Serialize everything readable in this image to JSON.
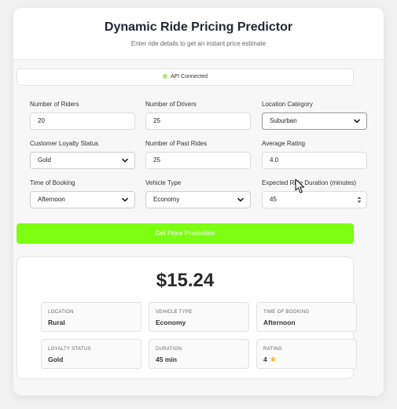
{
  "header": {
    "title": "Dynamic Ride Pricing Predictor",
    "subtitle": "Enter ride details to get an instant price estimate"
  },
  "status": {
    "text": "API Connected",
    "color": "#b6e37a"
  },
  "form": {
    "riders": {
      "label": "Number of Riders",
      "value": "20"
    },
    "drivers": {
      "label": "Number of Drivers",
      "value": "25"
    },
    "location": {
      "label": "Location Category",
      "value": "Suburban"
    },
    "loyalty": {
      "label": "Customer Loyalty Status",
      "value": "Gold"
    },
    "past_rides": {
      "label": "Number of Past Rides",
      "value": "25"
    },
    "rating": {
      "label": "Average Rating",
      "value": "4.0"
    },
    "time": {
      "label": "Time of Booking",
      "value": "Afternoon"
    },
    "vehicle": {
      "label": "Vehicle Type",
      "value": "Economy"
    },
    "duration": {
      "label": "Expected Ride Duration (minutes)",
      "value": "45"
    }
  },
  "predict_button": {
    "label": "Get Price Prediction",
    "color": "#7cff11"
  },
  "result": {
    "price": "$15.24",
    "tiles": [
      {
        "key": "LOCATION",
        "value": "Rural"
      },
      {
        "key": "VEHICLE TYPE",
        "value": "Economy"
      },
      {
        "key": "TIME OF BOOKING",
        "value": "Afternoon"
      },
      {
        "key": "LOYALTY STATUS",
        "value": "Gold"
      },
      {
        "key": "DURATION",
        "value": "45 min"
      },
      {
        "key": "RATING",
        "value": "4"
      }
    ]
  },
  "icons": {
    "star": "star-icon",
    "chevron": "chevron-down-icon",
    "cursor": "mouse-pointer-icon"
  }
}
